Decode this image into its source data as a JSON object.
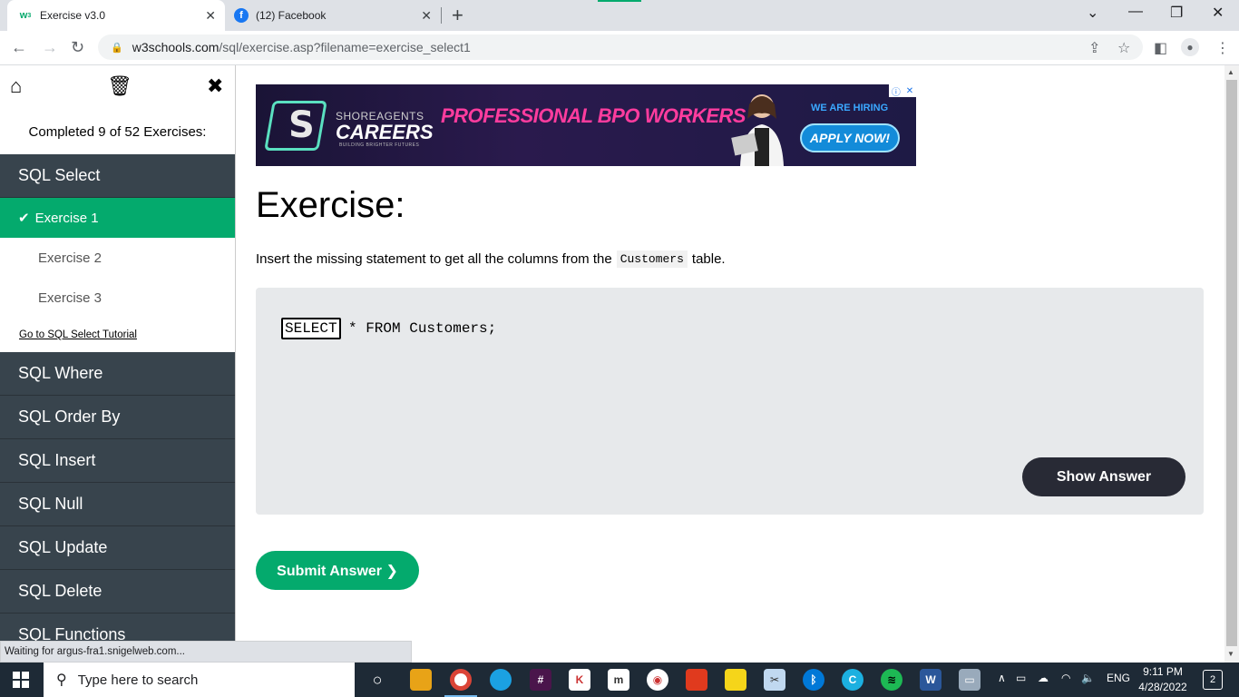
{
  "browser": {
    "tabs": [
      {
        "title": "Exercise v3.0",
        "favicon": "w3-icon",
        "active": true
      },
      {
        "title": "(12) Facebook",
        "favicon": "facebook-icon",
        "active": false
      }
    ],
    "url_domain": "w3schools.com",
    "url_path": "/sql/exercise.asp?filename=exercise_select1",
    "status_text": "Waiting for argus-fra1.snigelweb.com..."
  },
  "sidebar": {
    "completed_text": "Completed 9 of 52 Exercises:",
    "active_category": "SQL Select",
    "exercises": [
      {
        "label": "Exercise 1",
        "active": true
      },
      {
        "label": "Exercise 2",
        "active": false
      },
      {
        "label": "Exercise 3",
        "active": false
      }
    ],
    "tutorial_link": "Go to SQL Select Tutorial",
    "categories": [
      "SQL Where",
      "SQL Order By",
      "SQL Insert",
      "SQL Null",
      "SQL Update",
      "SQL Delete",
      "SQL Functions"
    ]
  },
  "ad": {
    "brand_top": "SHOREAGENTS",
    "brand_main": "CAREERS",
    "brand_tagline": "BUILDING BRIGHTER FUTURES",
    "headline": "PROFESSIONAL BPO WORKERS",
    "hiring": "WE ARE HIRING",
    "cta": "APPLY NOW!"
  },
  "exercise": {
    "title": "Exercise:",
    "desc_before": "Insert the missing statement to get all the columns from the",
    "desc_code": "Customers",
    "desc_after": "table.",
    "answer_value": "SELECT",
    "code_rest": "* FROM Customers;",
    "show_answer": "Show Answer",
    "submit": "Submit Answer ❯"
  },
  "taskbar": {
    "search_placeholder": "Type here to search",
    "language": "ENG",
    "time": "9:11 PM",
    "date": "4/28/2022",
    "notifications": "2"
  },
  "colors": {
    "accent_green": "#04aa6d",
    "sidebar_dark": "#38444d",
    "button_dark": "#282a35"
  }
}
